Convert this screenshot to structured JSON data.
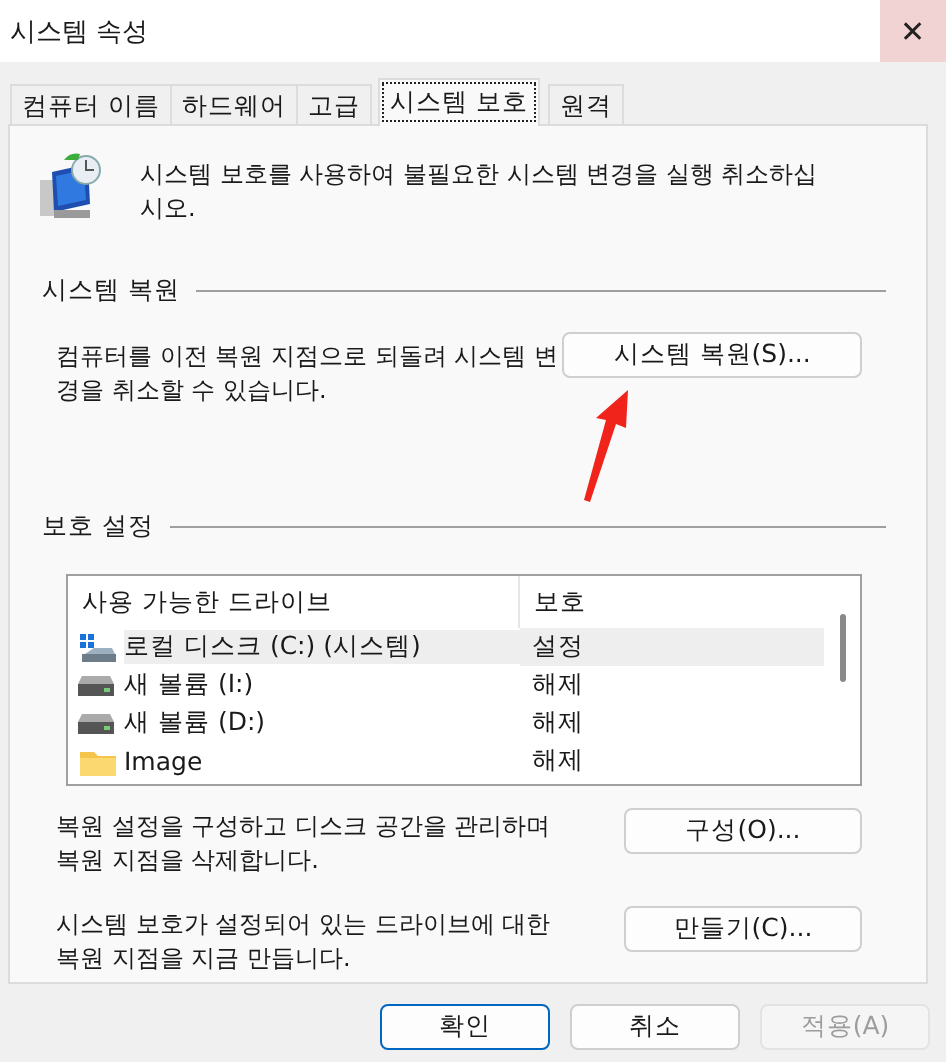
{
  "window": {
    "title": "시스템 속성",
    "close": "✕"
  },
  "tabs": [
    {
      "label": "컴퓨터 이름",
      "selected": false
    },
    {
      "label": "하드웨어",
      "selected": false
    },
    {
      "label": "고급",
      "selected": false
    },
    {
      "label": "시스템 보호",
      "selected": true
    },
    {
      "label": "원격",
      "selected": false
    }
  ],
  "intro": "시스템 보호를 사용하여 불필요한 시스템 변경을 실행 취소하십시오.",
  "restore": {
    "heading": "시스템 복원",
    "text": "컴퓨터를 이전 복원 지점으로 되돌려 시스템 변경을 취소할 수 있습니다.",
    "button": "시스템 복원(S)..."
  },
  "protection": {
    "heading": "보호 설정",
    "table": {
      "columns": [
        "사용 가능한 드라이브",
        "보호"
      ],
      "rows": [
        {
          "kind": "system",
          "drive": "로컬 디스크 (C:) (시스템)",
          "protection": "설정",
          "selected": true
        },
        {
          "kind": "drive",
          "drive": "새 볼륨 (I:)",
          "protection": "해제",
          "selected": false
        },
        {
          "kind": "drive",
          "drive": "새 볼륨 (D:)",
          "protection": "해제",
          "selected": false
        },
        {
          "kind": "folder",
          "drive": "Image",
          "protection": "해제",
          "selected": false
        }
      ]
    },
    "actions": [
      {
        "text": "복원 설정을 구성하고 디스크 공간을 관리하며 복원 지점을 삭제합니다.",
        "button": "구성(O)..."
      },
      {
        "text": "시스템 보호가 설정되어 있는 드라이브에 대한 복원 지점을 지금 만듭니다.",
        "button": "만들기(C)..."
      }
    ]
  },
  "buttons": [
    {
      "label": "확인",
      "kind": "default",
      "disabled": false
    },
    {
      "label": "취소",
      "kind": "normal",
      "disabled": false
    },
    {
      "label": "적용(A)",
      "kind": "normal",
      "disabled": true
    }
  ],
  "annotation": {
    "kind": "arrow"
  }
}
